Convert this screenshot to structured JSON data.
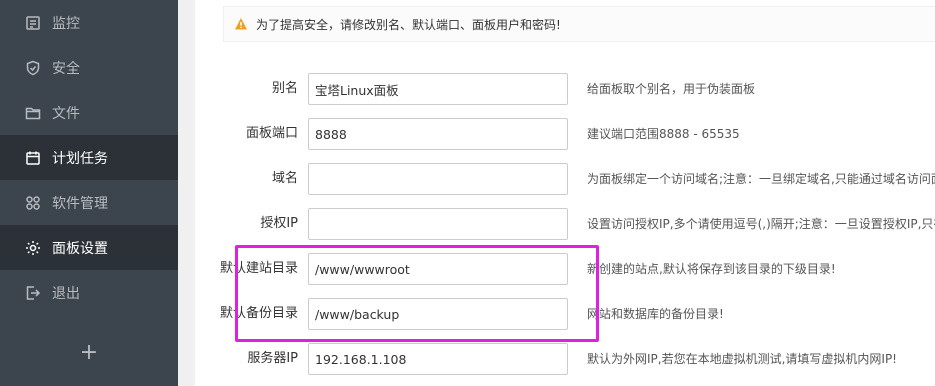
{
  "sidebar": {
    "items": [
      {
        "label": "监控",
        "icon": "monitor-icon",
        "active": false
      },
      {
        "label": "安全",
        "icon": "shield-icon",
        "active": false
      },
      {
        "label": "文件",
        "icon": "folder-icon",
        "active": false
      },
      {
        "label": "计划任务",
        "icon": "calendar-icon",
        "active": true
      },
      {
        "label": "软件管理",
        "icon": "apps-icon",
        "active": false
      },
      {
        "label": "面板设置",
        "icon": "gear-icon",
        "active": true
      },
      {
        "label": "退出",
        "icon": "logout-icon",
        "active": false
      }
    ],
    "add_label": "+"
  },
  "notice": {
    "text": "为了提高安全，请修改别名、默认端口、面板用户和密码!"
  },
  "form": {
    "rows": [
      {
        "label": "别名",
        "value": "宝塔Linux面板",
        "hint": "给面板取个别名，用于伪装面板"
      },
      {
        "label": "面板端口",
        "value": "8888",
        "hint": "建议端口范围8888 - 65535"
      },
      {
        "label": "域名",
        "value": "",
        "hint": "为面板绑定一个访问域名;注意：一旦绑定域名,只能通过域名访问面"
      },
      {
        "label": "授权IP",
        "value": "",
        "hint": "设置访问授权IP,多个请使用逗号(,)隔开;注意：一旦设置授权IP,只有"
      },
      {
        "label": "默认建站目录",
        "value": "/www/wwwroot",
        "hint": "新创建的站点,默认将保存到该目录的下级目录!"
      },
      {
        "label": "默认备份目录",
        "value": "/www/backup",
        "hint": "网站和数据库的备份目录!"
      },
      {
        "label": "服务器IP",
        "value": "192.168.1.108",
        "hint": "默认为外网IP,若您在本地虚拟机测试,请填写虚拟机内网IP!"
      }
    ]
  },
  "colors": {
    "sidebar_bg": "#3c444d",
    "sidebar_active_bg": "#2c3138",
    "highlight": "#e020e0",
    "warning": "#f0a020"
  }
}
